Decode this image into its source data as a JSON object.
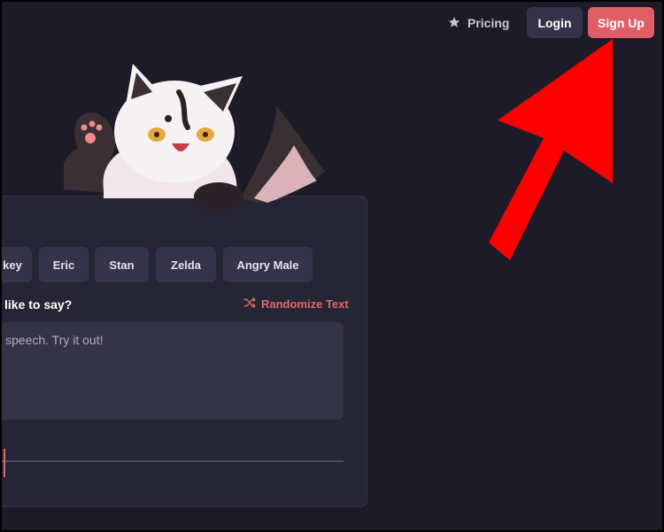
{
  "nav": {
    "pricing_label": "Pricing",
    "login_label": "Login",
    "signup_label": "Sign Up"
  },
  "voices": [
    "key",
    "Eric",
    "Stan",
    "Zelda",
    "Angry Male"
  ],
  "prompt": {
    "label": "like to say?",
    "randomize_label": "Randomize Text",
    "textarea_value": "speech. Try it out!"
  },
  "colors": {
    "background": "#1c1b27",
    "card": "#262535",
    "accent": "#e05f66",
    "chip": "#34334a"
  },
  "icons": {
    "pricing": "star-icon",
    "randomize": "shuffle-icon",
    "annotation": "red-arrow"
  }
}
